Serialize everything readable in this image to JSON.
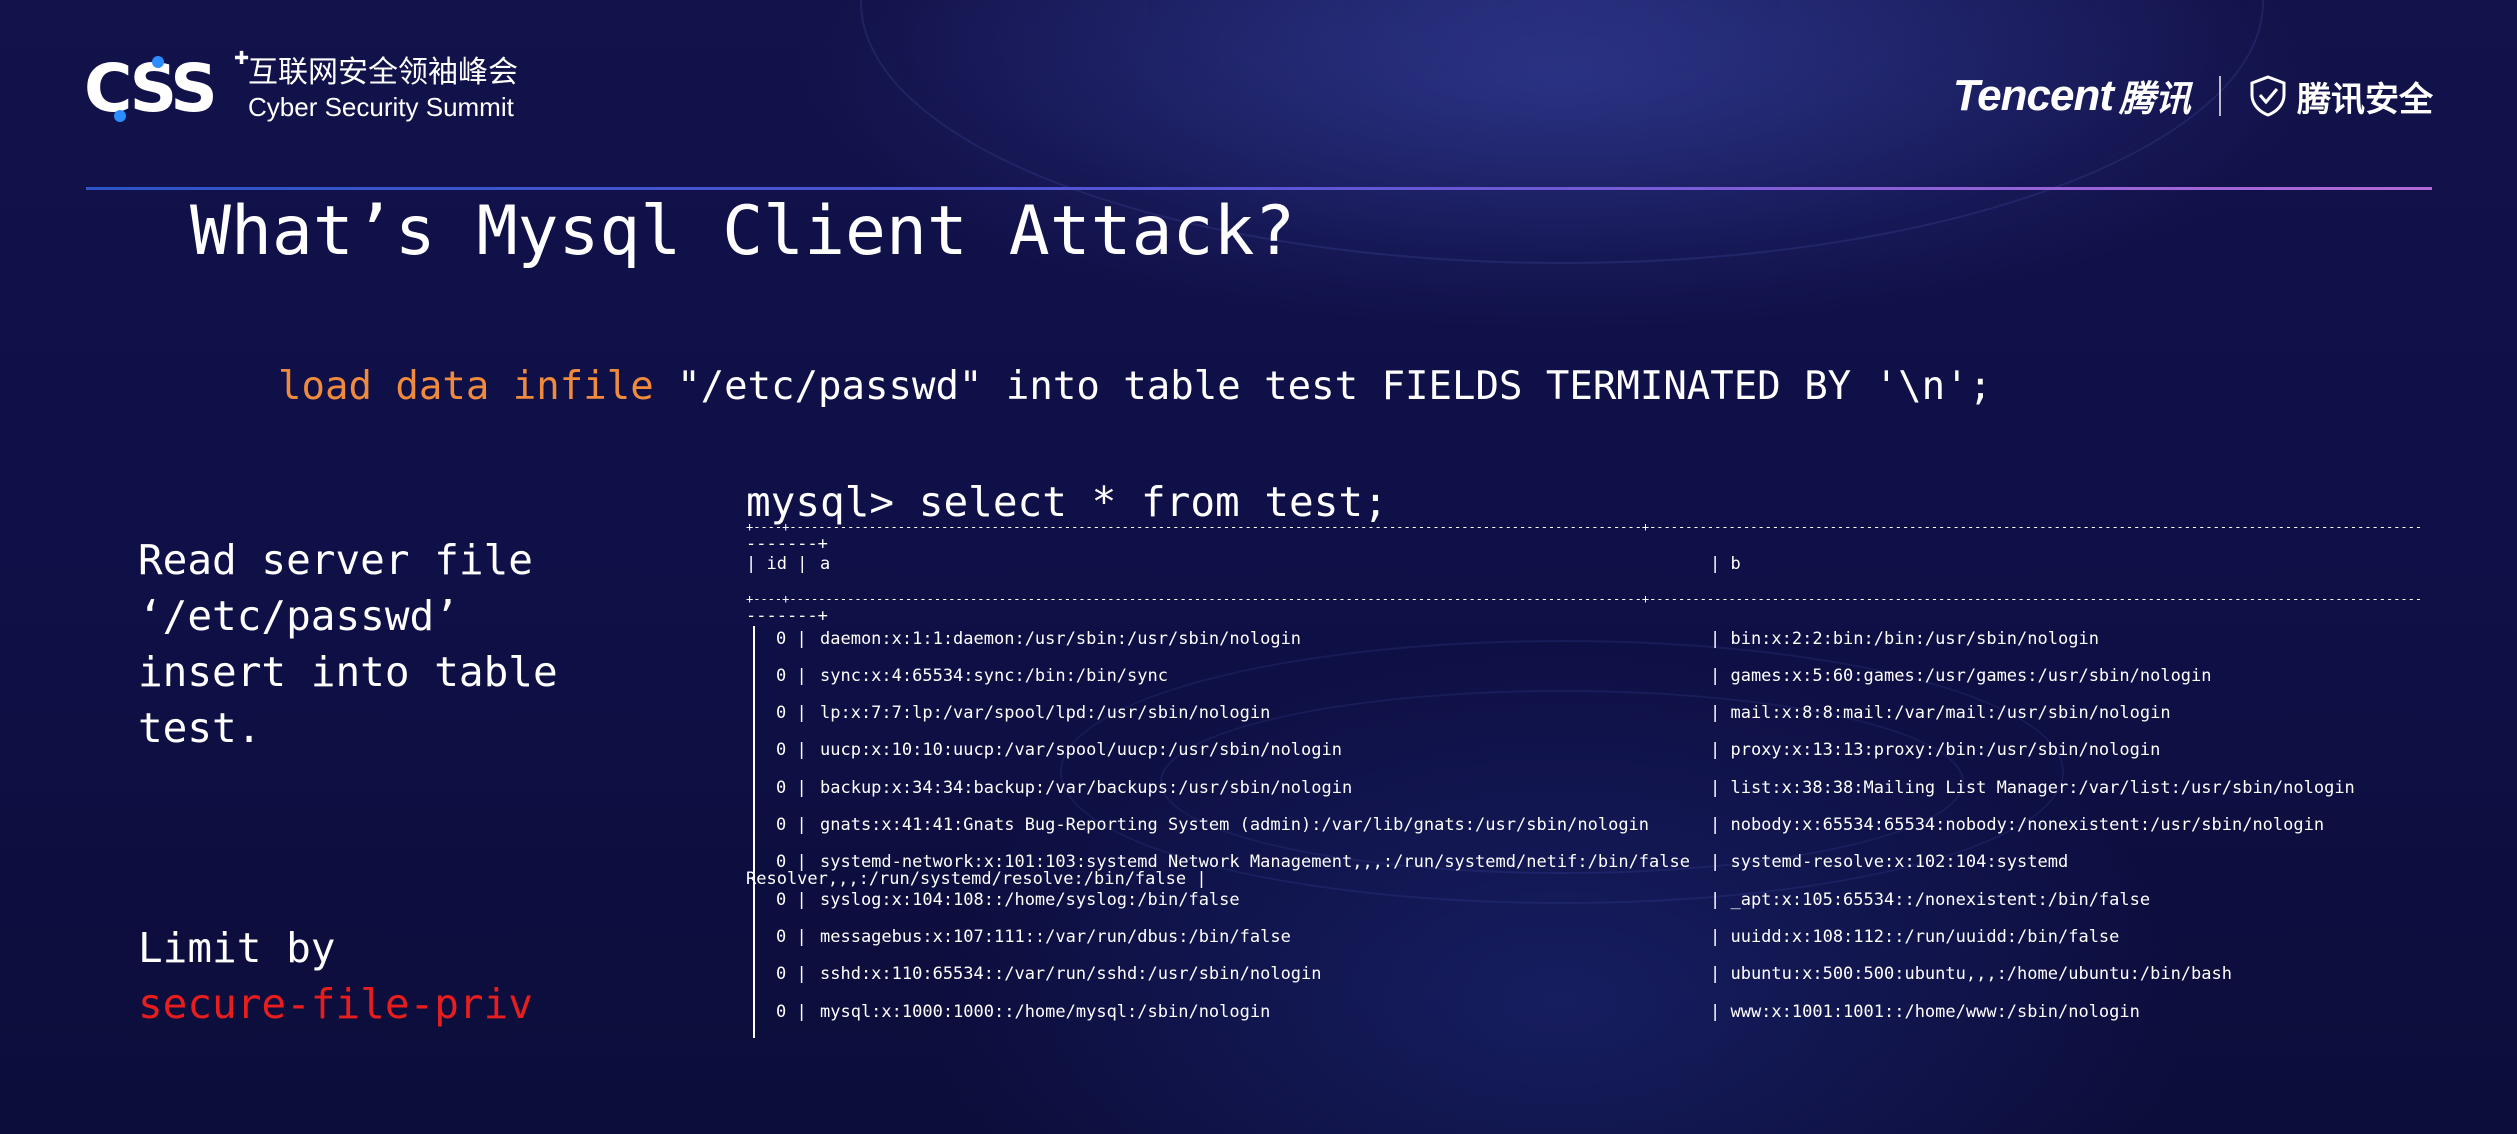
{
  "header": {
    "logo_mark": "CSS",
    "logo_cn": "互联网安全领袖峰会",
    "logo_en": "Cyber Security Summit",
    "tencent_en": "Tencent",
    "tencent_cn": "腾讯",
    "security_cn": "腾讯安全"
  },
  "title": "What’s Mysql Client Attack?",
  "sql": {
    "keyword": "load data infile",
    "rest": " \"/etc/passwd\" into table test FIELDS TERMINATED BY '\\n';"
  },
  "left_desc": [
    "Read server file",
    "‘/etc/passwd’",
    "insert into table",
    "test."
  ],
  "limit": {
    "label": "Limit by",
    "value": "secure-file-priv"
  },
  "terminal": {
    "command": "mysql> select * from test;",
    "sep_top": "+----+----------------------------------------------------------------------------------------------------------------------+-----------------------------------------------------------------------------------------------------------",
    "sep_tail": "-------+",
    "headers": {
      "id": "| id |",
      "a": "a",
      "b": "| b"
    },
    "rows": [
      {
        "id": "0 |",
        "a": "daemon:x:1:1:daemon:/usr/sbin:/usr/sbin/nologin",
        "b": "| bin:x:2:2:bin:/bin:/usr/sbin/nologin"
      },
      {
        "id": "0 |",
        "a": "sync:x:4:65534:sync:/bin:/bin/sync",
        "b": "| games:x:5:60:games:/usr/games:/usr/sbin/nologin"
      },
      {
        "id": "0 |",
        "a": "lp:x:7:7:lp:/var/spool/lpd:/usr/sbin/nologin",
        "b": "| mail:x:8:8:mail:/var/mail:/usr/sbin/nologin"
      },
      {
        "id": "0 |",
        "a": "uucp:x:10:10:uucp:/var/spool/uucp:/usr/sbin/nologin",
        "b": "| proxy:x:13:13:proxy:/bin:/usr/sbin/nologin"
      },
      {
        "id": "0 |",
        "a": "backup:x:34:34:backup:/var/backups:/usr/sbin/nologin",
        "b": "| list:x:38:38:Mailing List Manager:/var/list:/usr/sbin/nologin"
      },
      {
        "id": "0 |",
        "a": "gnats:x:41:41:Gnats Bug-Reporting System (admin):/var/lib/gnats:/usr/sbin/nologin",
        "b": "| nobody:x:65534:65534:nobody:/nonexistent:/usr/sbin/nologin"
      },
      {
        "id": "0 |",
        "a": "systemd-network:x:101:103:systemd Network Management,,,:/run/systemd/netif:/bin/false",
        "b": "| systemd-resolve:x:102:104:systemd"
      },
      {
        "id": "0 |",
        "a": "syslog:x:104:108::/home/syslog:/bin/false",
        "b": "| _apt:x:105:65534::/nonexistent:/bin/false"
      },
      {
        "id": "0 |",
        "a": "messagebus:x:107:111::/var/run/dbus:/bin/false",
        "b": "| uuidd:x:108:112::/run/uuidd:/bin/false"
      },
      {
        "id": "0 |",
        "a": "sshd:x:110:65534::/var/run/sshd:/usr/sbin/nologin",
        "b": "| ubuntu:x:500:500:ubuntu,,,:/home/ubuntu:/bin/bash"
      },
      {
        "id": "0 |",
        "a": "mysql:x:1000:1000::/home/mysql:/sbin/nologin",
        "b": "| www:x:1001:1001::/home/www:/sbin/nologin"
      }
    ],
    "wrap_line": "Resolver,,,:/run/systemd/resolve:/bin/false |"
  }
}
